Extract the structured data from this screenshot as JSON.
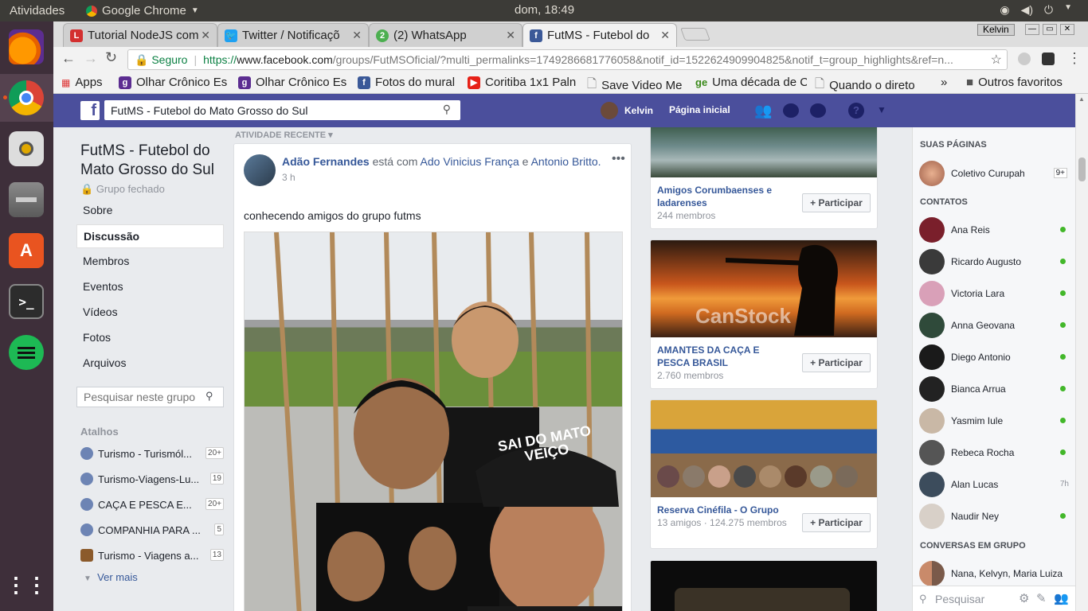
{
  "topbar": {
    "activities": "Atividades",
    "app": "Google Chrome",
    "clock": "dom, 18:49"
  },
  "launcher": {
    "icons": [
      "firefox-icon",
      "chrome-icon",
      "rhythmbox-icon",
      "files-icon",
      "software-center-icon",
      "terminal-icon",
      "spotify-icon",
      "show-apps-icon"
    ]
  },
  "chrome": {
    "tabs": [
      {
        "label": "Tutorial NodeJS com",
        "favicon": "L",
        "color": "#d32f2f"
      },
      {
        "label": "Twitter / Notificaçõ",
        "favicon": "t",
        "color": "#1da1f2"
      },
      {
        "label": "(2) WhatsApp",
        "favicon": "2",
        "color": "#4caf50"
      },
      {
        "label": "FutMS - Futebol do",
        "favicon": "f",
        "color": "#3b5998"
      }
    ],
    "user": "Kelvin",
    "secure": "Seguro",
    "url_scheme": "https://",
    "url_host": "www.facebook.com",
    "url_path": "/groups/FutMSOficial/?multi_permalinks=1749286681776058&notif_id=1522624909904825&notif_t=group_highlights&ref=n...",
    "bookmarks": [
      {
        "label": "Apps",
        "icon": "apps-icon",
        "color": "#555"
      },
      {
        "label": "Olhar Crônico Es",
        "icon": "g",
        "color": "#5c2d91"
      },
      {
        "label": "Olhar Crônico Es",
        "icon": "g",
        "color": "#5c2d91"
      },
      {
        "label": "Fotos do mural",
        "icon": "f",
        "color": "#3b5998"
      },
      {
        "label": "Coritiba 1x1 Paln",
        "icon": "▶",
        "color": "#e62117"
      },
      {
        "label": "Save Video Me",
        "icon": "page",
        "color": "#777"
      },
      {
        "label": "Uma década de C",
        "icon": "ge",
        "color": "#3a8a1a"
      },
      {
        "label": "Quando o direto",
        "icon": "page",
        "color": "#777"
      }
    ],
    "more": "»",
    "other": "Outros favoritos"
  },
  "fb": {
    "search_value": "FutMS - Futebol do Mato Grosso do Sul",
    "user": "Kelvin",
    "home": "Página inicial"
  },
  "left": {
    "group_name": "FutMS - Futebol do Mato Grosso do Sul",
    "privacy": "Grupo fechado",
    "nav": [
      "Sobre",
      "Discussão",
      "Membros",
      "Eventos",
      "Vídeos",
      "Fotos",
      "Arquivos"
    ],
    "search_placeholder": "Pesquisar neste grupo",
    "shortcuts_title": "Atalhos",
    "shortcuts": [
      {
        "label": "Turismo - Turismól...",
        "count": "20+"
      },
      {
        "label": "Turismo-Viagens-Lu...",
        "count": "19"
      },
      {
        "label": "CAÇA E PESCA E...",
        "count": "20+"
      },
      {
        "label": "COMPANHIA PARA ...",
        "count": "5"
      },
      {
        "label": "Turismo - Viagens a...",
        "count": "13"
      }
    ],
    "see_more": "Ver mais"
  },
  "feed": {
    "section": "ATIVIDADE RECENTE",
    "author": "Adão Fernandes",
    "with_text": "está com",
    "tag1": "Ado Vinicius França",
    "and": "e",
    "tag2": "Antonio Britto.",
    "time": "3 h",
    "body": "conhecendo amigos do grupo futms",
    "cap_text": "SAI DO MATO VEIÇO"
  },
  "groups": [
    {
      "name": "Amigos Corumbaenses e ladarenses",
      "meta": "244 membros",
      "join": "+ Participar"
    },
    {
      "name": "AMANTES DA CAÇA E PESCA BRASIL",
      "meta": "2.760 membros",
      "join": "+ Participar",
      "watermark": "CanStock"
    },
    {
      "name": "Reserva Cinéfila - O Grupo",
      "meta": "13 amigos · 124.275 membros",
      "join": "+ Participar"
    }
  ],
  "chat": {
    "pages_title": "SUAS PÁGINAS",
    "page": {
      "name": "Coletivo Curupah",
      "badge": "9+"
    },
    "contacts_title": "CONTATOS",
    "contacts": [
      {
        "name": "Ana Reis",
        "status": "online",
        "color": "#7a1f2b"
      },
      {
        "name": "Ricardo Augusto",
        "status": "online",
        "color": "#3a3a3a"
      },
      {
        "name": "Victoria Lara",
        "status": "online",
        "color": "#d9a0b8"
      },
      {
        "name": "Anna Geovana",
        "status": "online",
        "color": "#2f4a3a"
      },
      {
        "name": "Diego Antonio",
        "status": "online",
        "color": "#1a1a1a"
      },
      {
        "name": "Bianca Arrua",
        "status": "online",
        "color": "#222"
      },
      {
        "name": "Yasmim Iule",
        "status": "online",
        "color": "#c9b8a6"
      },
      {
        "name": "Rebeca Rocha",
        "status": "online",
        "color": "#555"
      },
      {
        "name": "Alan Lucas",
        "status": "7h",
        "color": "#3c4c5c"
      },
      {
        "name": "Naudir Ney",
        "status": "online",
        "color": "#d8d0c8"
      }
    ],
    "groups_title": "CONVERSAS EM GRUPO",
    "group_conv": "Nana, Kelvyn, Maria Luiza",
    "search_placeholder": "Pesquisar"
  }
}
